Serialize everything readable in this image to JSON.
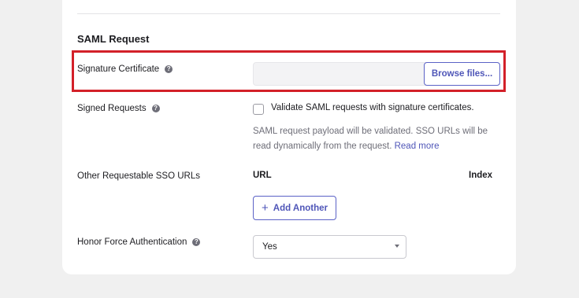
{
  "section": {
    "title": "SAML Request"
  },
  "signature_certificate": {
    "label": "Signature Certificate",
    "browse_label": "Browse files..."
  },
  "signed_requests": {
    "label": "Signed Requests",
    "checkbox_label": "Validate SAML requests with signature certificates.",
    "checked": false,
    "helper_text": "SAML request payload will be validated. SSO URLs will be read dynamically from the request.",
    "read_more_label": "Read more"
  },
  "other_sso_urls": {
    "label": "Other Requestable SSO URLs",
    "col_url": "URL",
    "col_index": "Index",
    "add_label": "Add Another"
  },
  "honor_force_auth": {
    "label": "Honor Force Authentication",
    "selected": "Yes"
  },
  "icons": {
    "help": "help-circle-icon",
    "plus": "plus-icon",
    "chevron": "chevron-down-icon"
  },
  "colors": {
    "accent": "#4f56b8",
    "highlight": "#d32029"
  }
}
